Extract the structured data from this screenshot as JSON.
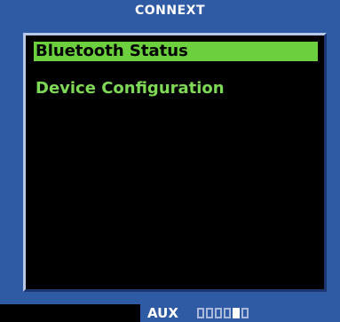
{
  "header": {
    "title": "CONNEXT"
  },
  "menu": {
    "items": [
      {
        "label": "Bluetooth Status",
        "selected": true
      },
      {
        "label": "Device Configuration",
        "selected": false
      }
    ]
  },
  "footer": {
    "page_group": "AUX",
    "page_indicator": {
      "count": 6,
      "active_index": 4
    }
  },
  "colors": {
    "frame": "#2f5aa4",
    "menu_text": "#7ed957",
    "highlight": "#6ccf3d",
    "background": "#000000"
  }
}
